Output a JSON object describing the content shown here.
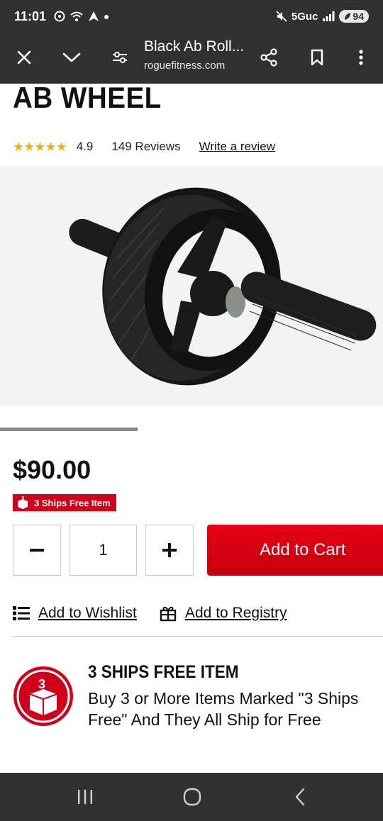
{
  "status_bar": {
    "time": "11:01",
    "network": "5Guc",
    "battery": "94"
  },
  "browser": {
    "page_title": "Black Ab Roll...",
    "url": "roguefitness.com"
  },
  "product": {
    "name": "AB WHEEL",
    "rating": "4.9",
    "stars": "★★★★★",
    "star_count": 5,
    "reviews": "149 Reviews",
    "write_review": "Write a review",
    "price": "$90.00",
    "badge_label": "3 Ships Free Item",
    "carousel_progress": 0.36
  },
  "purchase": {
    "minus_label": "−",
    "quantity": "1",
    "plus_label": "+",
    "add_to_cart": "Add to Cart"
  },
  "links": {
    "wishlist": "Add to Wishlist",
    "registry": "Add to Registry"
  },
  "ships_free": {
    "icon_number": "3",
    "title": "3 SHIPS FREE ITEM",
    "description": "Buy 3 or More Items Marked \"3 Ships Free\" And They All Ship for Free"
  },
  "colors": {
    "accent_red": "#d0021b",
    "star_gold": "#f2b01e",
    "toolbar_bg": "#2f3133"
  }
}
